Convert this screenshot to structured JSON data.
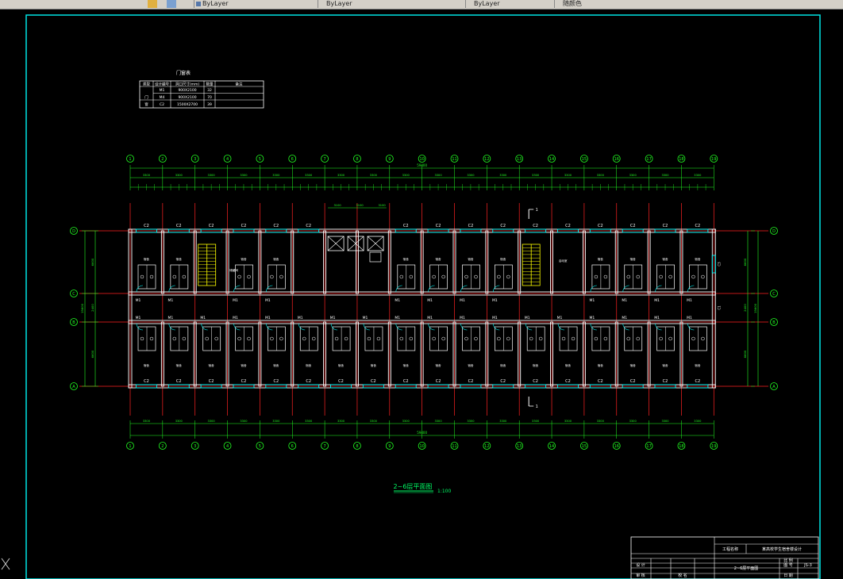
{
  "toolbar": {
    "tabs": [
      {
        "label": "ByLayer"
      },
      {
        "label": "ByLayer"
      },
      {
        "label": "ByLayer"
      },
      {
        "label": "随颜色"
      }
    ]
  },
  "door_table": {
    "title": "门窗表",
    "headers": [
      "类型",
      "设计编号",
      "洞口尺寸(mm)",
      "数量",
      "备注"
    ],
    "rows": [
      {
        "type": "",
        "code": "M1",
        "size": "900X2100",
        "qty": "32",
        "note": ""
      },
      {
        "type": "门",
        "code": "M4",
        "size": "900X2100",
        "qty": "70",
        "note": ""
      },
      {
        "type": "窗",
        "code": "C2",
        "size": "1500X2700",
        "qty": "39",
        "note": ""
      }
    ]
  },
  "grid_numbers": [
    "1",
    "2",
    "3",
    "4",
    "5",
    "6",
    "7",
    "8",
    "9",
    "10",
    "11",
    "12",
    "13",
    "14",
    "15",
    "16",
    "17",
    "18",
    "19"
  ],
  "grid_letters": [
    "D",
    "C",
    "B",
    "A"
  ],
  "dims": {
    "top_overall": "59400",
    "top_spans": [
      "3300",
      "3300",
      "3300",
      "3300",
      "3300",
      "3300",
      "3300",
      "3300",
      "3300",
      "3300",
      "3300",
      "3300",
      "3300",
      "3300",
      "3300",
      "3300",
      "3300",
      "3300"
    ],
    "bottom_overall": "59400",
    "bottom_spans": [
      "3300",
      "3300",
      "3300",
      "3300",
      "3300",
      "3300",
      "3300",
      "3300",
      "3300",
      "3300",
      "3300",
      "3300",
      "3300",
      "3300",
      "3300",
      "3300",
      "3300",
      "3300"
    ],
    "left_total": "15600",
    "left_parts": [
      "6600",
      "2400",
      "6600"
    ],
    "right_total": "15600",
    "right_parts": [
      "6600",
      "2400",
      "6600"
    ],
    "stair_dims": [
      "3100",
      "3100",
      "3100"
    ]
  },
  "labels": {
    "window": "C2",
    "door": "M1",
    "room": "宿舍",
    "section": "1",
    "closet": "储藏间",
    "hall": "活动室",
    "vertical_window": "C3",
    "vertical_door": "C1"
  },
  "drawing": {
    "title": "2~6层平面图",
    "scale": "1:100"
  },
  "title_block": {
    "project_label": "工程名称",
    "project_name": "某高校学生宿舍楼设计",
    "sheet_title": "2~6层平面图",
    "drawn_label": "设 计",
    "number_label": "图 号",
    "number": "JS-3",
    "scale_label": "比 例",
    "school_label": "校 名",
    "check_label": "审 核",
    "date_label": "日 期"
  },
  "colors": {
    "frame": "#00e5e5",
    "grid_line": "#ff2222",
    "dimension": "#22ff22",
    "wall": "#ffffff",
    "stair": "#ffff00",
    "window": "#00ffff"
  }
}
